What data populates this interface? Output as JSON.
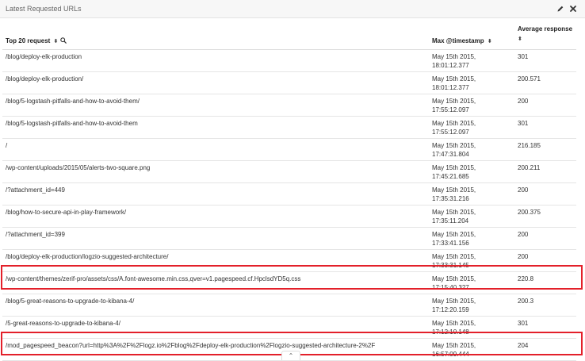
{
  "panel": {
    "title": "Latest Requested URLs",
    "edit_icon": "pencil-icon",
    "close_icon": "close-icon"
  },
  "table": {
    "headers": {
      "url": "Top 20 request",
      "timestamp": "Max @timestamp",
      "avg": "Average response"
    },
    "rows": [
      {
        "url": "/blog/deploy-elk-production",
        "ts_date": "May 15th 2015,",
        "ts_time": "18:01:12.377",
        "avg": "301"
      },
      {
        "url": "/blog/deploy-elk-production/",
        "ts_date": "May 15th 2015,",
        "ts_time": "18:01:12.377",
        "avg": "200.571"
      },
      {
        "url": "/blog/5-logstash-pitfalls-and-how-to-avoid-them/",
        "ts_date": "May 15th 2015,",
        "ts_time": "17:55:12.097",
        "avg": "200"
      },
      {
        "url": "/blog/5-logstash-pitfalls-and-how-to-avoid-them",
        "ts_date": "May 15th 2015,",
        "ts_time": "17:55:12.097",
        "avg": "301"
      },
      {
        "url": "/",
        "ts_date": "May 15th 2015,",
        "ts_time": "17:47:31.804",
        "avg": "216.185"
      },
      {
        "url": "/wp-content/uploads/2015/05/alerts-two-square.png",
        "ts_date": "May 15th 2015,",
        "ts_time": "17:45:21.685",
        "avg": "200.211"
      },
      {
        "url": "/?attachment_id=449",
        "ts_date": "May 15th 2015,",
        "ts_time": "17:35:31.216",
        "avg": "200"
      },
      {
        "url": "/blog/how-to-secure-api-in-play-framework/",
        "ts_date": "May 15th 2015,",
        "ts_time": "17:35:11.204",
        "avg": "200.375"
      },
      {
        "url": "/?attachment_id=399",
        "ts_date": "May 15th 2015,",
        "ts_time": "17:33:41.156",
        "avg": "200"
      },
      {
        "url": "/blog/deploy-elk-production/logzio-suggested-architecture/",
        "ts_date": "May 15th 2015,",
        "ts_time": "17:33:31.145",
        "avg": "200"
      },
      {
        "url": "/wp-content/themes/zerif-pro/assets/css/A.font-awesome.min.css,qver=v1.pagespeed.cf.HpclsdYD5q.css",
        "ts_date": "May 15th 2015,",
        "ts_time": "17:15:40.327",
        "avg": "220.8"
      },
      {
        "url": "/blog/5-great-reasons-to-upgrade-to-kibana-4/",
        "ts_date": "May 15th 2015,",
        "ts_time": "17:12:20.159",
        "avg": "200.3"
      },
      {
        "url": "/5-great-reasons-to-upgrade-to-kibana-4/",
        "ts_date": "May 15th 2015,",
        "ts_time": "17:12:10.148",
        "avg": "301"
      },
      {
        "url": "/mod_pagespeed_beacon?url=http%3A%2F%2Flogz.io%2Fblog%2Fdeploy-elk-production%2Flogzio-suggested-architecture-2%2F",
        "ts_date": "May 15th 2015,",
        "ts_time": "16:57:09.444",
        "avg": "204"
      }
    ]
  },
  "highlight_color": "#e3202a"
}
